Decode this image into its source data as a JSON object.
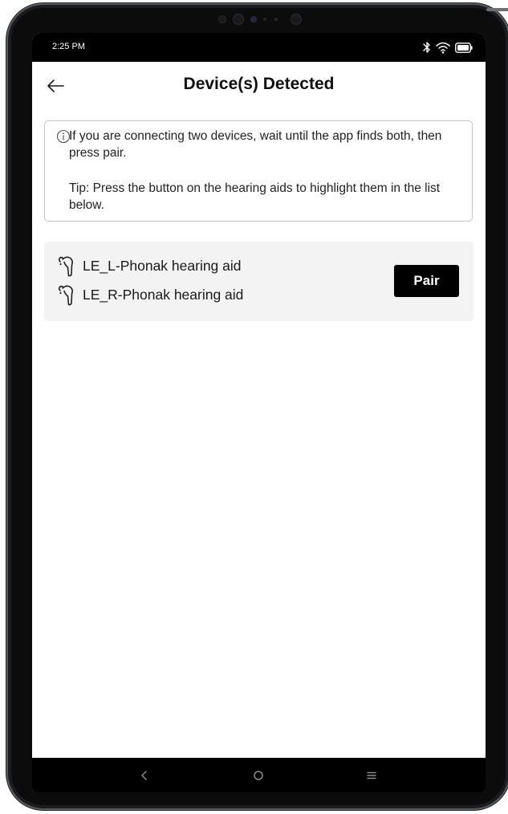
{
  "status_bar": {
    "time": "2:25 PM",
    "icons": [
      "bluetooth-icon",
      "wifi-icon",
      "battery-icon"
    ]
  },
  "header": {
    "title": "Device(s) Detected",
    "back_icon": "arrow-left-icon"
  },
  "info": {
    "icon": "info-circle-icon",
    "paragraph1": "If you are connecting two devices, wait until the app finds both, then press pair.",
    "paragraph2": "Tip: Press the button on the hearing aids to highlight them in the list below."
  },
  "devices": {
    "items": [
      {
        "name": "LE_L-Phonak hearing aid",
        "icon": "hearing-aid-icon"
      },
      {
        "name": "LE_R-Phonak hearing aid",
        "icon": "hearing-aid-icon"
      }
    ],
    "pair_label": "Pair"
  },
  "nav_bar": {
    "icons": [
      "nav-back-icon",
      "nav-home-icon",
      "nav-menu-icon"
    ]
  },
  "colors": {
    "button_bg": "#000000",
    "card_bg": "#f3f3f3",
    "info_border": "#c5c5c5"
  }
}
